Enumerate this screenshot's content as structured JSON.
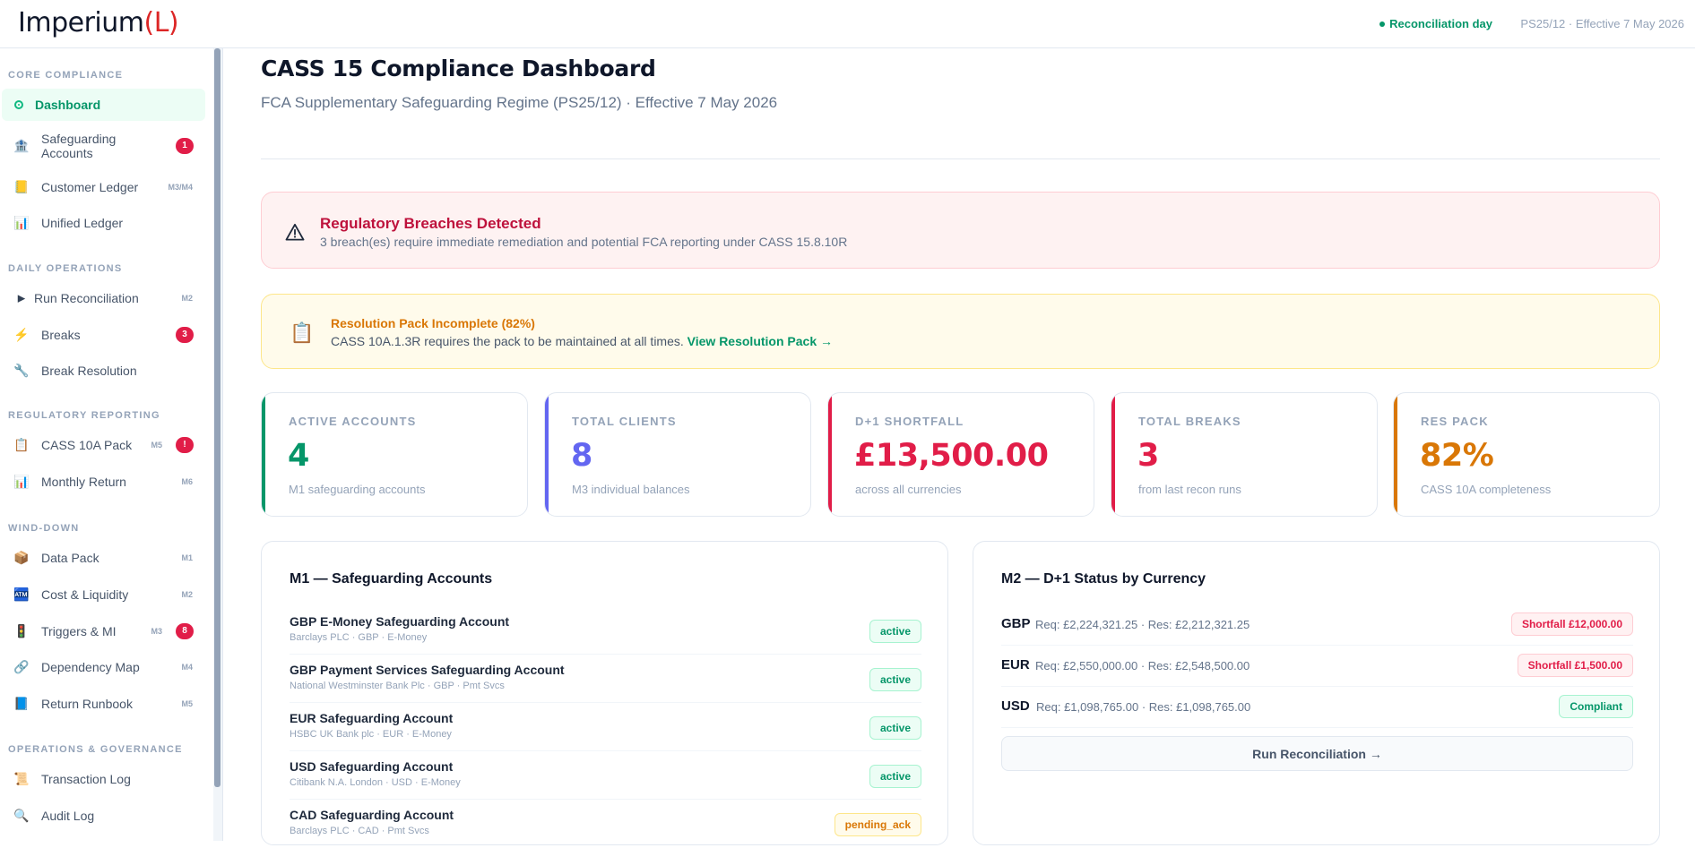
{
  "header": {
    "logo_text": "Imperium",
    "logo_paren": "(L)",
    "recon_status": "Reconciliation day",
    "effective": "PS25/12 · Effective 7 May 2026"
  },
  "sidebar": {
    "sections": [
      {
        "label": "CORE COMPLIANCE"
      },
      {
        "label": "DAILY OPERATIONS"
      },
      {
        "label": "REGULATORY REPORTING"
      },
      {
        "label": "WIND-DOWN"
      },
      {
        "label": "OPERATIONS & GOVERNANCE"
      }
    ],
    "items": [
      {
        "label": "Dashboard",
        "icon": "dashboard-dot-icon"
      },
      {
        "label": "Safeguarding\nAccounts",
        "icon": "bank-icon",
        "badge": "1"
      },
      {
        "label": "Customer Ledger",
        "icon": "ledger-icon",
        "tag": "M3/M4"
      },
      {
        "label": "Unified Ledger",
        "icon": "chart-icon"
      },
      {
        "label": "Run Reconciliation",
        "icon": "play-icon",
        "tag": "M2"
      },
      {
        "label": "Breaks",
        "icon": "lightning-icon",
        "badge": "3"
      },
      {
        "label": "Break Resolution",
        "icon": "wrench-icon"
      },
      {
        "label": "CASS 10A Pack",
        "icon": "clipboard-icon",
        "tag": "M5",
        "badge": "!"
      },
      {
        "label": "Monthly Return",
        "icon": "chart-icon",
        "tag": "M6"
      },
      {
        "label": "Data Pack",
        "icon": "package-icon",
        "tag": "M1"
      },
      {
        "label": "Cost & Liquidity",
        "icon": "atm-icon",
        "tag": "M2"
      },
      {
        "label": "Triggers & MI",
        "icon": "traffic-light-icon",
        "tag": "M3",
        "badge": "8"
      },
      {
        "label": "Dependency Map",
        "icon": "link-icon",
        "tag": "M4"
      },
      {
        "label": "Return Runbook",
        "icon": "book-icon",
        "tag": "M5"
      },
      {
        "label": "Transaction Log",
        "icon": "scroll-icon"
      },
      {
        "label": "Audit Log",
        "icon": "magnifier-icon"
      }
    ]
  },
  "page": {
    "title": "CASS 15 Compliance Dashboard",
    "subtitle": "FCA Supplementary Safeguarding Regime (PS25/12) · Effective 7 May 2026"
  },
  "alerts": {
    "breach": {
      "title": "Regulatory Breaches Detected",
      "desc": "3 breach(es) require immediate remediation and potential FCA reporting under CASS 15.8.10R"
    },
    "pack": {
      "title": "Resolution Pack Incomplete (82%)",
      "desc": "CASS 10A.1.3R requires the pack to be maintained at all times.",
      "link": "View Resolution Pack →"
    }
  },
  "stats": [
    {
      "label": "ACTIVE ACCOUNTS",
      "value": "4",
      "caption": "M1 safeguarding accounts",
      "color": "#059669"
    },
    {
      "label": "TOTAL CLIENTS",
      "value": "8",
      "caption": "M3 individual balances",
      "color": "#6366f1"
    },
    {
      "label": "D+1 SHORTFALL",
      "value": "£13,500.00",
      "caption": "across all currencies",
      "color": "#e11d48"
    },
    {
      "label": "TOTAL BREAKS",
      "value": "3",
      "caption": "from last recon runs",
      "color": "#e11d48"
    },
    {
      "label": "RES PACK",
      "value": "82%",
      "caption": "CASS 10A completeness",
      "color": "#d97706"
    }
  ],
  "accounts_card": {
    "title": "M1 — Safeguarding Accounts",
    "accounts": [
      {
        "name": "GBP E-Money Safeguarding Account",
        "meta": "Barclays PLC · GBP · E-Money",
        "status": "active"
      },
      {
        "name": "GBP Payment Services Safeguarding Account",
        "meta": "National Westminster Bank Plc · GBP · Pmt Svcs",
        "status": "active"
      },
      {
        "name": "EUR Safeguarding Account",
        "meta": "HSBC UK Bank plc · EUR · E-Money",
        "status": "active"
      },
      {
        "name": "USD Safeguarding Account",
        "meta": "Citibank N.A. London · USD · E-Money",
        "status": "active"
      },
      {
        "name": "CAD Safeguarding Account",
        "meta": "Barclays PLC · CAD · Pmt Svcs",
        "status": "pending_ack"
      }
    ]
  },
  "currency_card": {
    "title": "M2 — D+1 Status by Currency",
    "rows": [
      {
        "code": "GBP",
        "detail": "Req: £2,224,321.25 · Res: £2,212,321.25",
        "status": "Shortfall £12,000.00"
      },
      {
        "code": "EUR",
        "detail": "Req: £2,550,000.00 · Res: £2,548,500.00",
        "status": "Shortfall £1,500.00"
      },
      {
        "code": "USD",
        "detail": "Req: £1,098,765.00 · Res: £1,098,765.00",
        "status": "Compliant"
      }
    ],
    "button": "Run Reconciliation →"
  }
}
